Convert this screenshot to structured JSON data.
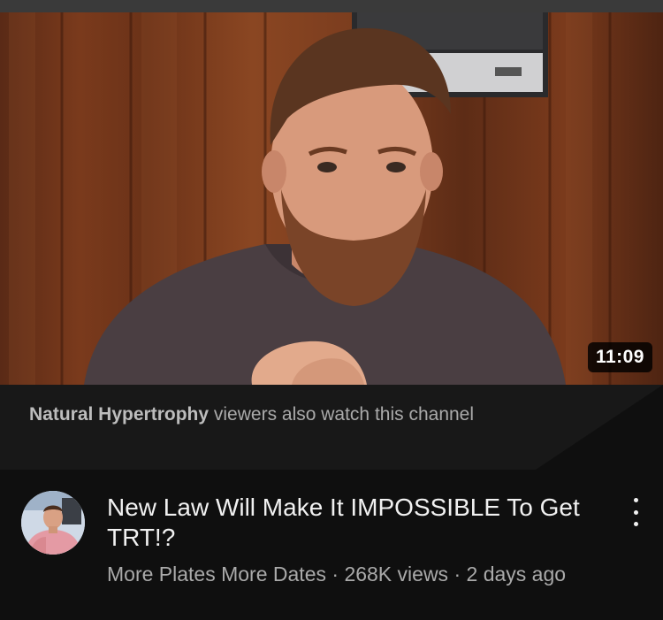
{
  "thumbnail": {
    "duration": "11:09",
    "icon": "video-thumbnail"
  },
  "recommendation_reason": {
    "channel": "Natural Hypertrophy",
    "rest": " viewers also watch this channel"
  },
  "video": {
    "title": "New Law Will Make It IMPOSSIBLE To Get TRT!?",
    "channel": "More Plates More Dates",
    "separator": " · ",
    "views": "268K views",
    "age": "2 days ago",
    "more_icon": "more-vert-icon"
  },
  "colors": {
    "background": "#0f0f0f",
    "title_text": "#f1f1f1",
    "secondary_text": "#aaaaaa"
  }
}
